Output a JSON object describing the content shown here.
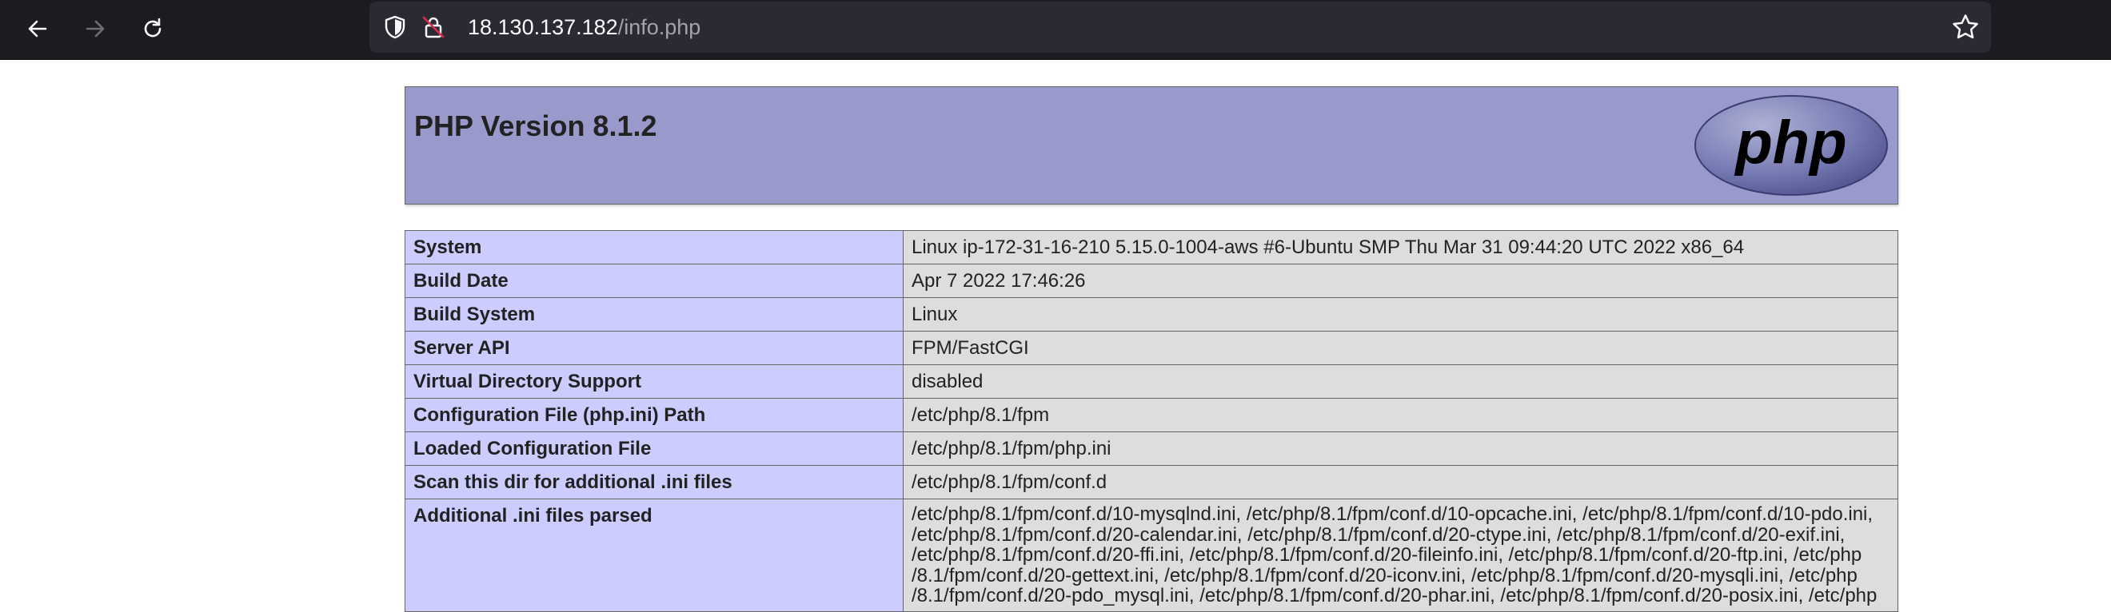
{
  "browser": {
    "url_host": "18.130.137.182",
    "url_path": "/info.php",
    "icons": [
      "back-arrow-icon",
      "forward-arrow-icon",
      "reload-icon",
      "shield-icon",
      "insecure-lock-icon",
      "bookmark-star-icon"
    ]
  },
  "header": {
    "title": "PHP Version 8.1.2",
    "logo_text": "php"
  },
  "rows": [
    {
      "key": "System",
      "value": "Linux ip-172-31-16-210 5.15.0-1004-aws #6-Ubuntu SMP Thu Mar 31 09:44:20 UTC 2022 x86_64"
    },
    {
      "key": "Build Date",
      "value": "Apr 7 2022 17:46:26"
    },
    {
      "key": "Build System",
      "value": "Linux"
    },
    {
      "key": "Server API",
      "value": "FPM/FastCGI"
    },
    {
      "key": "Virtual Directory Support",
      "value": "disabled"
    },
    {
      "key": "Configuration File (php.ini) Path",
      "value": "/etc/php/8.1/fpm"
    },
    {
      "key": "Loaded Configuration File",
      "value": "/etc/php/8.1/fpm/php.ini"
    },
    {
      "key": "Scan this dir for additional .ini files",
      "value": "/etc/php/8.1/fpm/conf.d"
    }
  ],
  "additional_ini": {
    "key": "Additional .ini files parsed",
    "lines": [
      "/etc/php/8.1/fpm/conf.d/10-mysqlnd.ini, /etc/php/8.1/fpm/conf.d/10-opcache.ini, /etc/php/8.1/fpm/conf.d/10-pdo.ini,",
      "/etc/php/8.1/fpm/conf.d/20-calendar.ini, /etc/php/8.1/fpm/conf.d/20-ctype.ini, /etc/php/8.1/fpm/conf.d/20-exif.ini,",
      "/etc/php/8.1/fpm/conf.d/20-ffi.ini, /etc/php/8.1/fpm/conf.d/20-fileinfo.ini, /etc/php/8.1/fpm/conf.d/20-ftp.ini, /etc/php",
      "/8.1/fpm/conf.d/20-gettext.ini, /etc/php/8.1/fpm/conf.d/20-iconv.ini, /etc/php/8.1/fpm/conf.d/20-mysqli.ini, /etc/php",
      "/8.1/fpm/conf.d/20-pdo_mysql.ini, /etc/php/8.1/fpm/conf.d/20-phar.ini, /etc/php/8.1/fpm/conf.d/20-posix.ini, /etc/php"
    ]
  }
}
